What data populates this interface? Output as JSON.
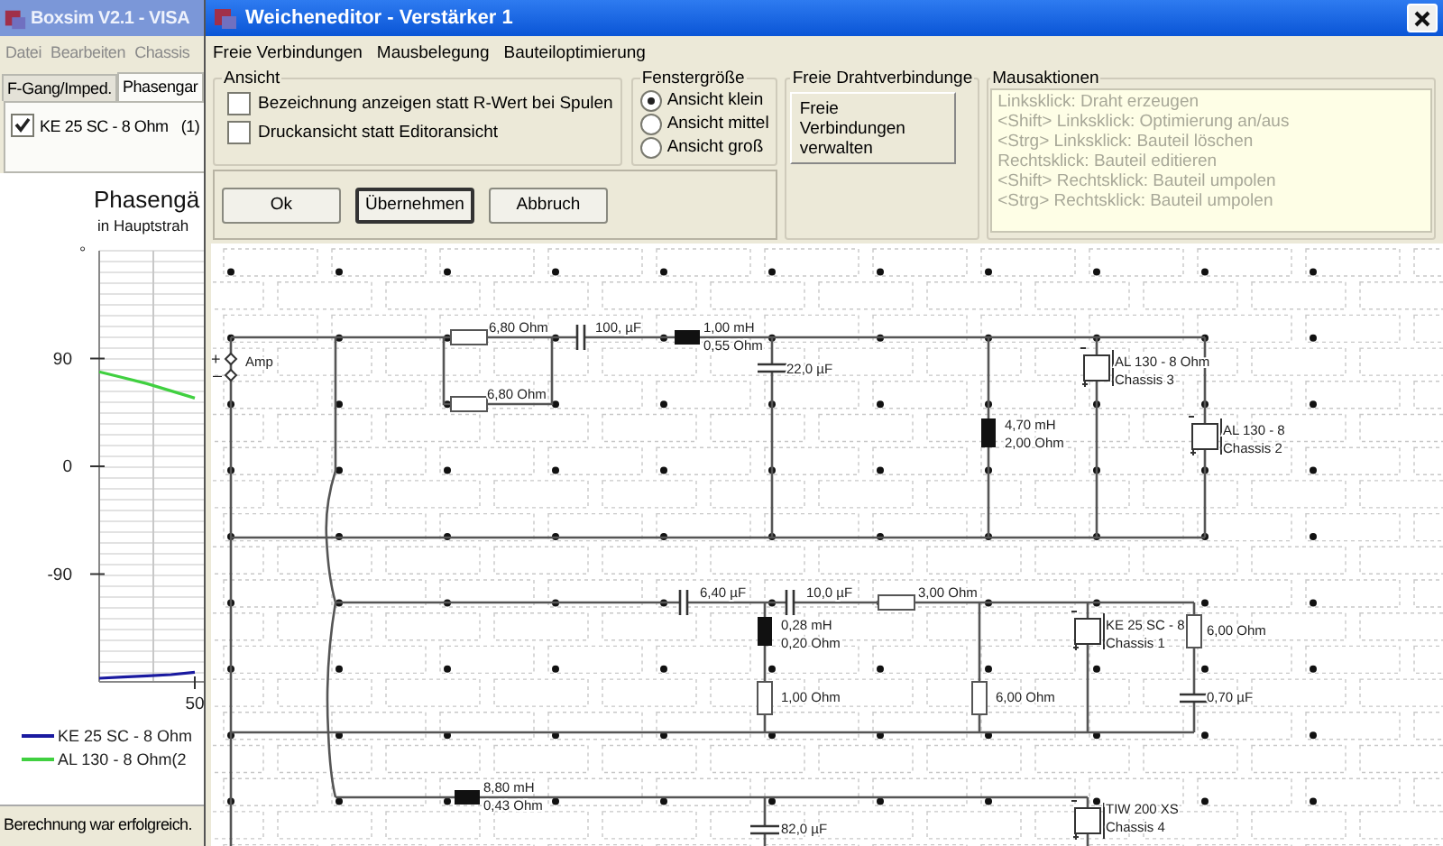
{
  "main_window": {
    "title": "Boxsim V2.1 - VISA",
    "menu": [
      "Datei",
      "Bearbeiten",
      "Chassis"
    ],
    "tabs": [
      {
        "label": "F-Gang/Imped.",
        "selected": false
      },
      {
        "label": "Phasengar",
        "selected": true
      }
    ],
    "driver_list": [
      {
        "label": "KE 25 SC - 8 Ohm",
        "number": "(1)",
        "checked": true
      }
    ],
    "chart_subtitle": "in Hauptstrah",
    "chart_data": {
      "type": "line",
      "title": "Phasengä",
      "ylabel": "°",
      "grid": true,
      "legend": "bottom",
      "ylim": [
        -180,
        180
      ],
      "yticks": [
        {
          "value": 90,
          "label": "90"
        },
        {
          "value": 0,
          "label": "0"
        },
        {
          "value": -90,
          "label": "-90"
        }
      ],
      "annotations": [
        {
          "text": "50"
        }
      ],
      "series": [
        {
          "name": "KE 25 SC - 8 Ohm",
          "color": "#1a1aa0",
          "values": [
            -177,
            -176,
            -175,
            -174,
            -172
          ]
        },
        {
          "name": "AL 130 - 8 Ohm(2",
          "color": "#40d040",
          "values": [
            79,
            74,
            69,
            63,
            57
          ]
        }
      ]
    },
    "status_bar": "Berechnung war erfolgreich."
  },
  "dialog": {
    "title": "Weicheneditor - Verstärker 1",
    "menu": [
      "Freie Verbindungen",
      "Mausbelegung",
      "Bauteiloptimierung"
    ],
    "view_group": {
      "title": "Ansicht",
      "options": [
        {
          "label": "Bezeichnung anzeigen statt R-Wert bei Spulen",
          "checked": false
        },
        {
          "label": "Druckansicht statt Editoransicht",
          "checked": false
        }
      ]
    },
    "size_group": {
      "title": "Fenstergröße",
      "options": [
        {
          "label": "Ansicht klein",
          "selected": true
        },
        {
          "label": "Ansicht mittel",
          "selected": false
        },
        {
          "label": "Ansicht groß",
          "selected": false
        }
      ]
    },
    "wire_group": {
      "title": "Freie Drahtverbindunge",
      "button": "Freie Verbindungen verwalten"
    },
    "mouse_group": {
      "title": "Mausaktionen",
      "lines": [
        "Linksklick: Draht erzeugen",
        "<Shift> Linksklick: Optimierung an/aus",
        "<Strg> Linksklick: Bauteil löschen",
        "Rechtsklick: Bauteil editieren",
        "<Shift> Rechtsklick: Bauteil umpolen",
        "<Strg> Rechtsklick: Bauteil umpolen"
      ]
    },
    "buttons": [
      {
        "label": "Ok",
        "default": false
      },
      {
        "label": "Übernehmen",
        "default": true
      },
      {
        "label": "Abbruch",
        "default": false
      }
    ],
    "circuit": {
      "amp": {
        "label": "Amp",
        "plus": "+",
        "minus": "–"
      },
      "components": [
        {
          "kind": "resistor",
          "labels": [
            "6,80 Ohm"
          ]
        },
        {
          "kind": "resistor",
          "labels": [
            "6,80 Ohm"
          ]
        },
        {
          "kind": "capacitor",
          "labels": [
            "100, µF"
          ]
        },
        {
          "kind": "inductor",
          "labels": [
            "1,00 mH",
            "0,55 Ohm"
          ]
        },
        {
          "kind": "capacitor",
          "labels": [
            "22,0 µF"
          ]
        },
        {
          "kind": "inductor",
          "labels": [
            "4,70 mH",
            "2,00 Ohm"
          ]
        },
        {
          "kind": "speaker",
          "labels": [
            "AL 130 - 8 Ohm",
            "Chassis 3"
          ]
        },
        {
          "kind": "speaker",
          "labels": [
            "AL 130 - 8",
            "Chassis 2"
          ]
        },
        {
          "kind": "capacitor",
          "labels": [
            "6,40 µF"
          ]
        },
        {
          "kind": "capacitor",
          "labels": [
            "10,0 µF"
          ]
        },
        {
          "kind": "resistor",
          "labels": [
            "3,00 Ohm"
          ]
        },
        {
          "kind": "inductor",
          "labels": [
            "0,28 mH",
            "0,20 Ohm"
          ]
        },
        {
          "kind": "resistor",
          "labels": [
            "1,00 Ohm"
          ]
        },
        {
          "kind": "resistor",
          "labels": [
            "6,00 Ohm"
          ]
        },
        {
          "kind": "speaker",
          "labels": [
            "KE 25 SC - 8",
            "Chassis 1"
          ]
        },
        {
          "kind": "resistor",
          "labels": [
            "6,00 Ohm"
          ]
        },
        {
          "kind": "capacitor",
          "labels": [
            "0,70 µF"
          ]
        },
        {
          "kind": "inductor",
          "labels": [
            "8,80 mH",
            "0,43 Ohm"
          ]
        },
        {
          "kind": "capacitor",
          "labels": [
            "82,0 µF"
          ]
        },
        {
          "kind": "speaker",
          "labels": [
            "TIW 200 XS",
            "Chassis 4"
          ]
        }
      ]
    }
  }
}
